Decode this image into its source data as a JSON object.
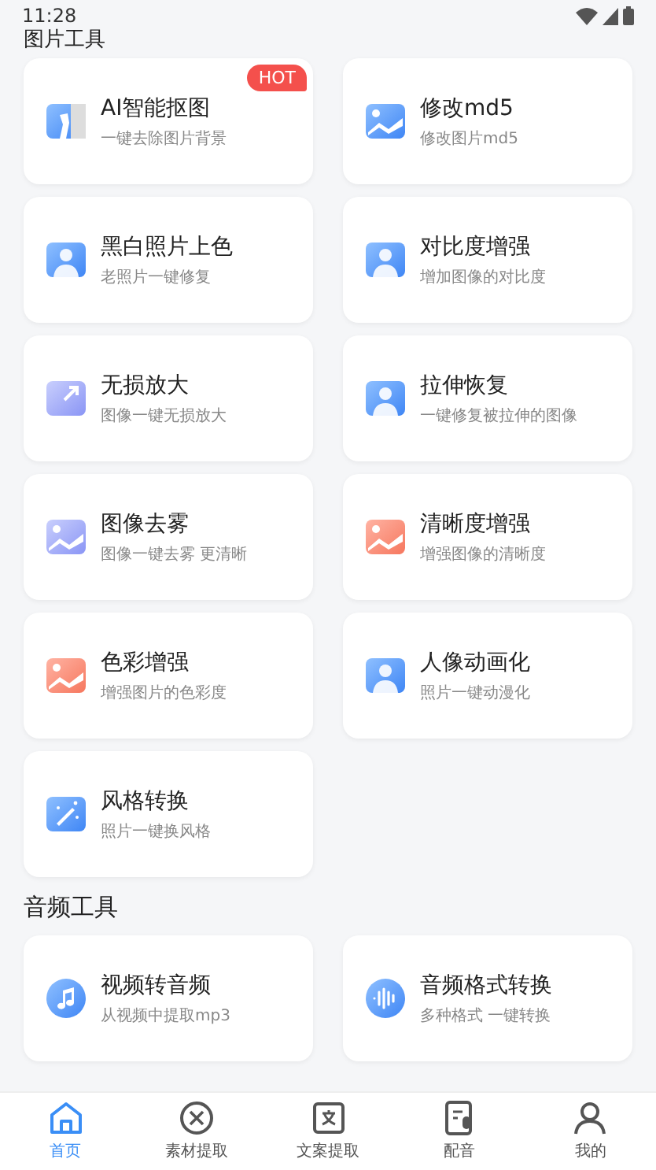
{
  "status_bar": {
    "time": "11:28"
  },
  "sections": [
    {
      "title": "图片工具",
      "tools": [
        {
          "title": "AI智能抠图",
          "subtitle": "一键去除图片背景",
          "badge": "HOT"
        },
        {
          "title": "修改md5",
          "subtitle": "修改图片md5"
        },
        {
          "title": "黑白照片上色",
          "subtitle": "老照片一键修复"
        },
        {
          "title": "对比度增强",
          "subtitle": "增加图像的对比度"
        },
        {
          "title": "无损放大",
          "subtitle": "图像一键无损放大"
        },
        {
          "title": "拉伸恢复",
          "subtitle": "一键修复被拉伸的图像"
        },
        {
          "title": "图像去雾",
          "subtitle": "图像一键去雾 更清晰"
        },
        {
          "title": "清晰度增强",
          "subtitle": "增强图像的清晰度"
        },
        {
          "title": "色彩增强",
          "subtitle": "增强图片的色彩度"
        },
        {
          "title": "人像动画化",
          "subtitle": "照片一键动漫化"
        },
        {
          "title": "风格转换",
          "subtitle": "照片一键换风格"
        }
      ]
    },
    {
      "title": "音频工具",
      "tools": [
        {
          "title": "视频转音频",
          "subtitle": "从视频中提取mp3"
        },
        {
          "title": "音频格式转换",
          "subtitle": "多种格式 一键转换"
        }
      ]
    }
  ],
  "tab_bar": [
    {
      "label": "首页",
      "selected": true
    },
    {
      "label": "素材提取",
      "selected": false
    },
    {
      "label": "文案提取",
      "selected": false
    },
    {
      "label": "配音",
      "selected": false
    },
    {
      "label": "我的",
      "selected": false
    }
  ]
}
